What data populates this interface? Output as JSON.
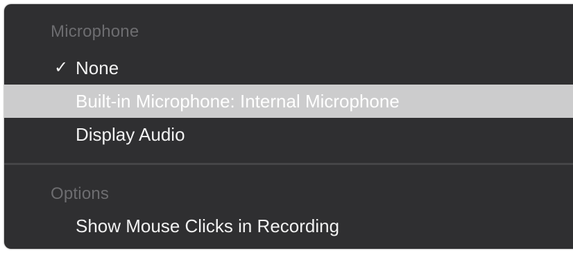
{
  "menu": {
    "microphone_header": "Microphone",
    "microphone_items": [
      {
        "label": "None",
        "checked": true
      },
      {
        "label": "Built-in Microphone: Internal Microphone",
        "highlighted": true
      },
      {
        "label": "Display Audio"
      }
    ],
    "check_glyph": "✓",
    "options_header": "Options",
    "options_items": [
      {
        "label": "Show Mouse Clicks in Recording"
      }
    ]
  },
  "colors": {
    "menu_background": "#2f2f31",
    "header_text": "#6d6d70",
    "item_text": "#f2f2f2",
    "highlight_background": "#cccccd"
  }
}
